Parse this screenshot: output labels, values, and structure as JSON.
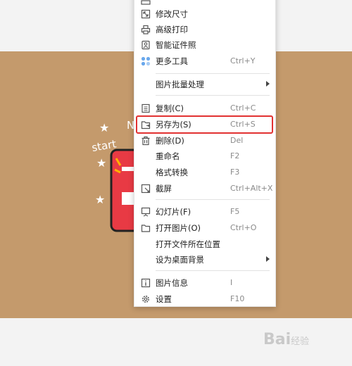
{
  "menu": {
    "items": [
      {
        "label": "修改尺寸",
        "shortcut": "",
        "icon": "resize-icon"
      },
      {
        "label": "高级打印",
        "shortcut": "",
        "icon": "printer-icon"
      },
      {
        "label": "智能证件照",
        "shortcut": "",
        "icon": "id-photo-icon"
      },
      {
        "label": "更多工具",
        "shortcut": "Ctrl+Y",
        "icon": "more-tools-icon"
      },
      {
        "label": "图片批量处理",
        "shortcut": "",
        "icon": ""
      },
      {
        "label": "复制(C)",
        "shortcut": "Ctrl+C",
        "icon": "copy-icon"
      },
      {
        "label": "另存为(S)",
        "shortcut": "Ctrl+S",
        "icon": "save-as-icon"
      },
      {
        "label": "删除(D)",
        "shortcut": "Del",
        "icon": "trash-icon"
      },
      {
        "label": "重命名",
        "shortcut": "F2",
        "icon": ""
      },
      {
        "label": "格式转换",
        "shortcut": "F3",
        "icon": ""
      },
      {
        "label": "截屏",
        "shortcut": "Ctrl+Alt+X",
        "icon": "screenshot-icon"
      },
      {
        "label": "幻灯片(F)",
        "shortcut": "F5",
        "icon": "slideshow-icon"
      },
      {
        "label": "打开图片(O)",
        "shortcut": "Ctrl+O",
        "icon": "folder-icon"
      },
      {
        "label": "打开文件所在位置",
        "shortcut": "",
        "icon": ""
      },
      {
        "label": "设为桌面背景",
        "shortcut": "",
        "icon": ""
      },
      {
        "label": "图片信息",
        "shortcut": "I",
        "icon": "info-icon"
      },
      {
        "label": "设置",
        "shortcut": "F10",
        "icon": "gear-icon"
      }
    ]
  },
  "sticker": {
    "text": "start"
  },
  "watermark": {
    "brand": "Bai",
    "suffix": "经验"
  },
  "colors": {
    "background": "#c49a6c",
    "highlight": "#e23232",
    "accent": "#4a90e2"
  }
}
